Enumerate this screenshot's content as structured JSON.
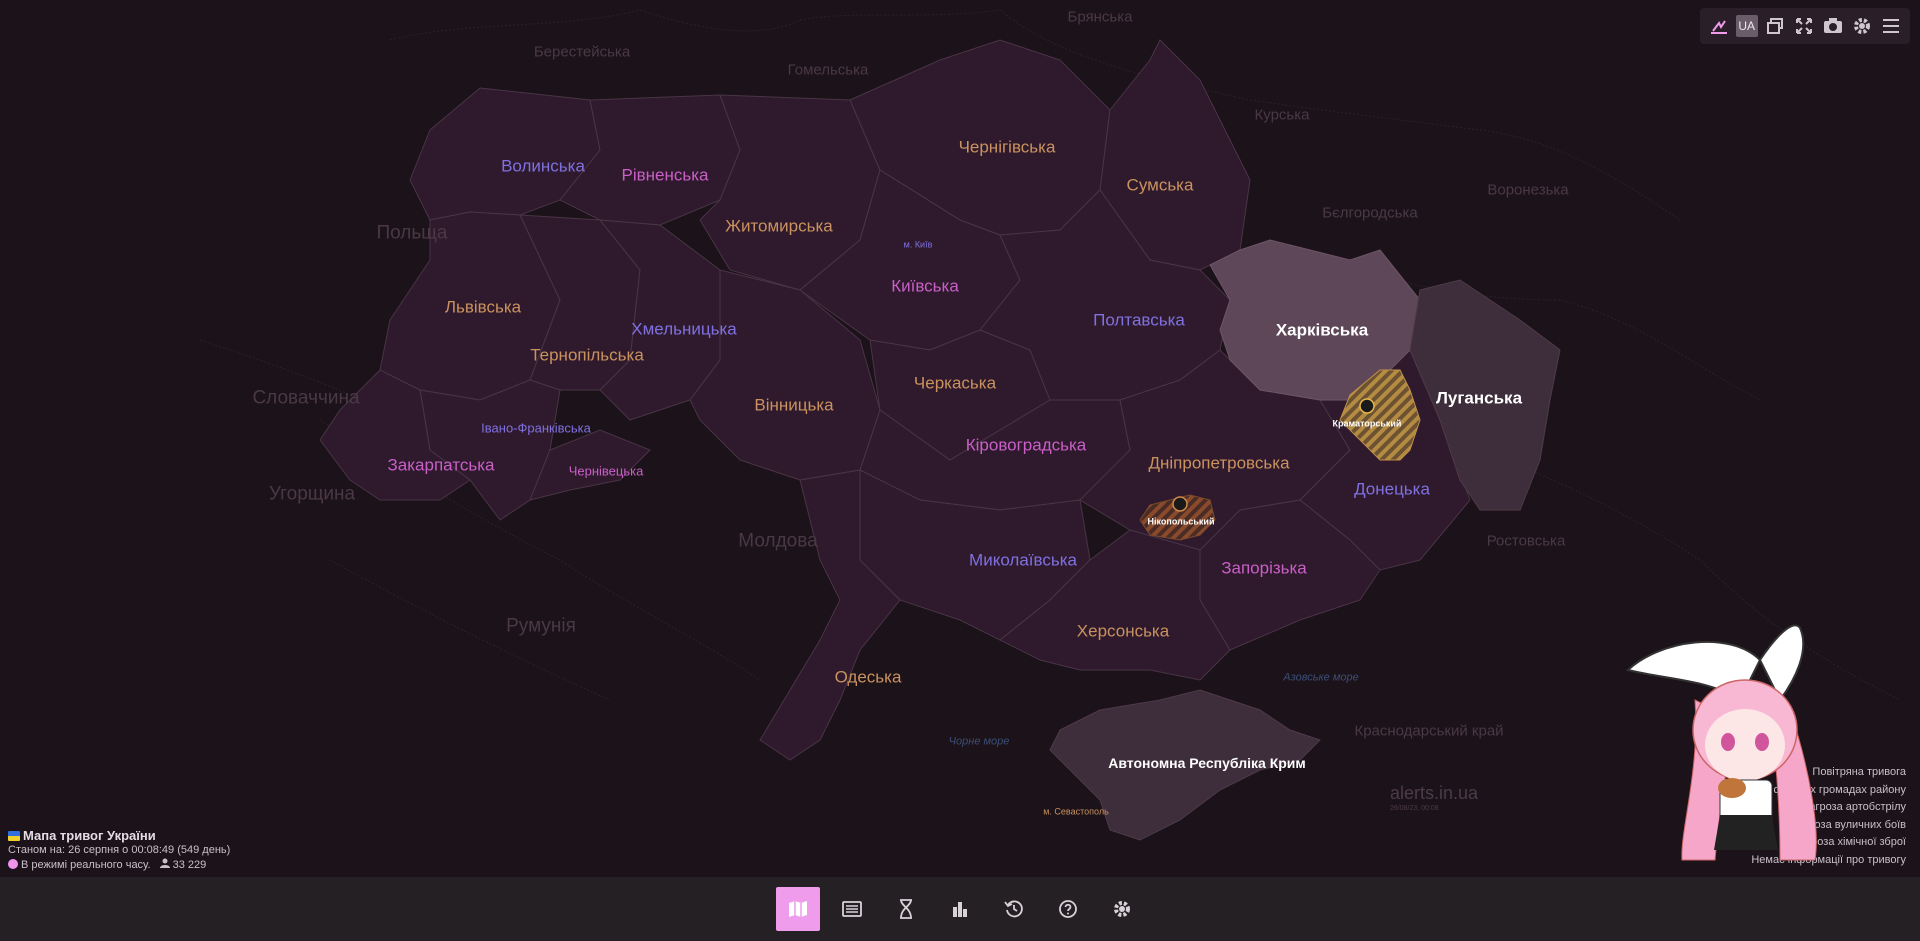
{
  "map": {
    "countries": [
      "Берестейська",
      "Гомельська",
      "Брянська",
      "Курська",
      "Воронезька",
      "Бєлгородська",
      "Польща",
      "Словаччина",
      "Угорщина",
      "Молдова",
      "Румунія",
      "Ростовська",
      "Краснодарський край"
    ],
    "seas": [
      "Азовське море",
      "Чорне море"
    ],
    "oblasts": [
      {
        "name": "Волинська",
        "status": "no-alert",
        "color": "#7f71e0"
      },
      {
        "name": "Рівненська",
        "status": "no-alert",
        "color": "#c95fc7"
      },
      {
        "name": "Житомирська",
        "status": "no-alert",
        "color": "#c9925e"
      },
      {
        "name": "Чернігівська",
        "status": "no-alert",
        "color": "#c9925e"
      },
      {
        "name": "Сумська",
        "status": "no-alert",
        "color": "#c9925e"
      },
      {
        "name": "Львівська",
        "status": "no-alert",
        "color": "#c9925e"
      },
      {
        "name": "Хмельницька",
        "status": "no-alert",
        "color": "#7f71e0"
      },
      {
        "name": "Тернопільська",
        "status": "no-alert",
        "color": "#c9925e"
      },
      {
        "name": "Київська",
        "status": "no-alert",
        "color": "#c95fc7"
      },
      {
        "name": "Полтавська",
        "status": "no-alert",
        "color": "#7f71e0"
      },
      {
        "name": "Харківська",
        "status": "alert",
        "color": "#ffffff"
      },
      {
        "name": "Луганська",
        "status": "alert",
        "color": "#ffffff"
      },
      {
        "name": "Івано-Франківська",
        "status": "no-alert",
        "color": "#7f71e0"
      },
      {
        "name": "Закарпатська",
        "status": "no-alert",
        "color": "#c95fc7"
      },
      {
        "name": "Чернівецька",
        "status": "no-alert",
        "color": "#c95fc7"
      },
      {
        "name": "Вінницька",
        "status": "no-alert",
        "color": "#c9925e"
      },
      {
        "name": "Черкаська",
        "status": "no-alert",
        "color": "#c9925e"
      },
      {
        "name": "Кіровоградська",
        "status": "no-alert",
        "color": "#c95fc7"
      },
      {
        "name": "Дніпропетровська",
        "status": "no-alert",
        "color": "#c9925e"
      },
      {
        "name": "Донецька",
        "status": "no-alert",
        "color": "#7f71e0"
      },
      {
        "name": "Миколаївська",
        "status": "no-alert",
        "color": "#7f71e0"
      },
      {
        "name": "Запорізька",
        "status": "no-alert",
        "color": "#c95fc7"
      },
      {
        "name": "Херсонська",
        "status": "no-alert",
        "color": "#c9925e"
      },
      {
        "name": "Одеська",
        "status": "no-alert",
        "color": "#c9925e"
      },
      {
        "name": "Автономна Республіка Крим",
        "status": "alert",
        "color": "#ffffff"
      }
    ],
    "cities": [
      {
        "name": "м. Київ",
        "color": "#7f71e0"
      },
      {
        "name": "м. Севастополь",
        "color": "#c9925e"
      }
    ],
    "raions": [
      {
        "name": "Краматорський",
        "status": "alert-raion"
      },
      {
        "name": "Нікопольський",
        "status": "alert-raion"
      }
    ],
    "colors": {
      "background": "#1c1219",
      "oblast_fill": "#2f1a2d",
      "alert_fill": "#4a3446",
      "alert_fill_light": "#6a5466",
      "raion_alert": "#a8823c",
      "accent": "#ee9ceb"
    }
  },
  "toolbar": {
    "icons": [
      "explosion-icon",
      "ua-toggle",
      "windows-icon",
      "fullscreen-icon",
      "camera-icon",
      "gear-icon",
      "menu-icon"
    ],
    "ua_label": "UA"
  },
  "info": {
    "title": "Мапа тривог України",
    "status": "Станом на: 26 серпня о 00:08:49 (549 день)",
    "realtime": "В режимі реального часу.",
    "users": "33 229"
  },
  "watermark": {
    "site": "alerts.in.ua",
    "date": "26/08/23, 00:08"
  },
  "legend": {
    "items": [
      "Повітряна тривога",
      "Тривога в окремих громадах району",
      "Загроза артобстрілу",
      "Загроза вуличних боїв",
      "Загроза хімічної зброї",
      "Немає інформації про тривогу"
    ]
  },
  "bottom_nav": {
    "items": [
      {
        "icon": "map-icon",
        "active": true
      },
      {
        "icon": "list-icon",
        "active": false
      },
      {
        "icon": "hourglass-icon",
        "active": false
      },
      {
        "icon": "chart-icon",
        "active": false
      },
      {
        "icon": "history-icon",
        "active": false
      },
      {
        "icon": "help-icon",
        "active": false
      },
      {
        "icon": "settings-icon",
        "active": false
      }
    ]
  }
}
